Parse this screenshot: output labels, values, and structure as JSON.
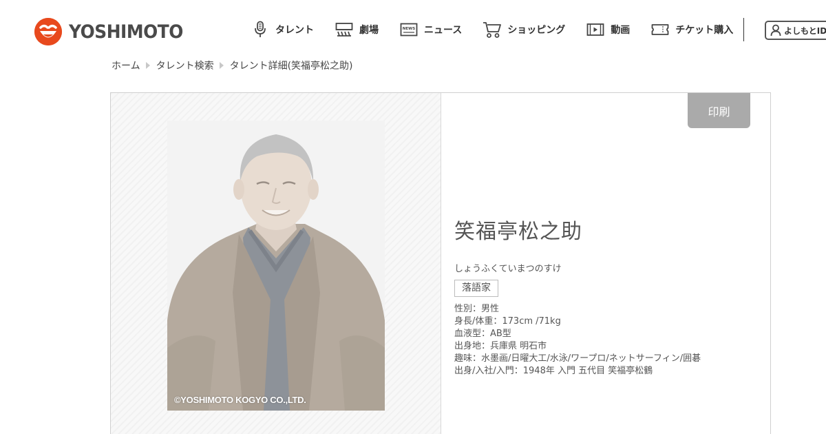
{
  "header": {
    "logo_text": "YOSHIMOTO",
    "nav": [
      {
        "label": "タレント",
        "icon": "microphone-icon"
      },
      {
        "label": "劇場",
        "icon": "theater-icon"
      },
      {
        "label": "ニュース",
        "icon": "news-icon"
      },
      {
        "label": "ショッピング",
        "icon": "shopping-cart-icon"
      },
      {
        "label": "動画",
        "icon": "video-icon"
      },
      {
        "label": "チケット購入",
        "icon": "ticket-icon"
      }
    ],
    "login_label": "よしもとID",
    "news_icon_text": "NEWS"
  },
  "breadcrumb": [
    "ホーム",
    "タレント検索",
    "タレント詳細(笑福亭松之助)"
  ],
  "profile": {
    "print_label": "印刷",
    "name": "笑福亭松之助",
    "kana": "しょうふくていまつのすけ",
    "category": "落語家",
    "details": [
      "性別：男性",
      "身長/体重：173cm /71kg",
      "血液型：AB型",
      "出身地：兵庫県 明石市",
      "趣味：水墨画/日曜大工/水泳/ワープロ/ネットサーフィン/囲碁",
      "出身/入社/入門：1948年 入門 五代目 笑福亭松鶴"
    ],
    "photo_credit": "©YOSHIMOTO KOGYO CO.,LTD."
  },
  "colors": {
    "brand": "#e8491d",
    "print_button": "#aaaaaa"
  }
}
